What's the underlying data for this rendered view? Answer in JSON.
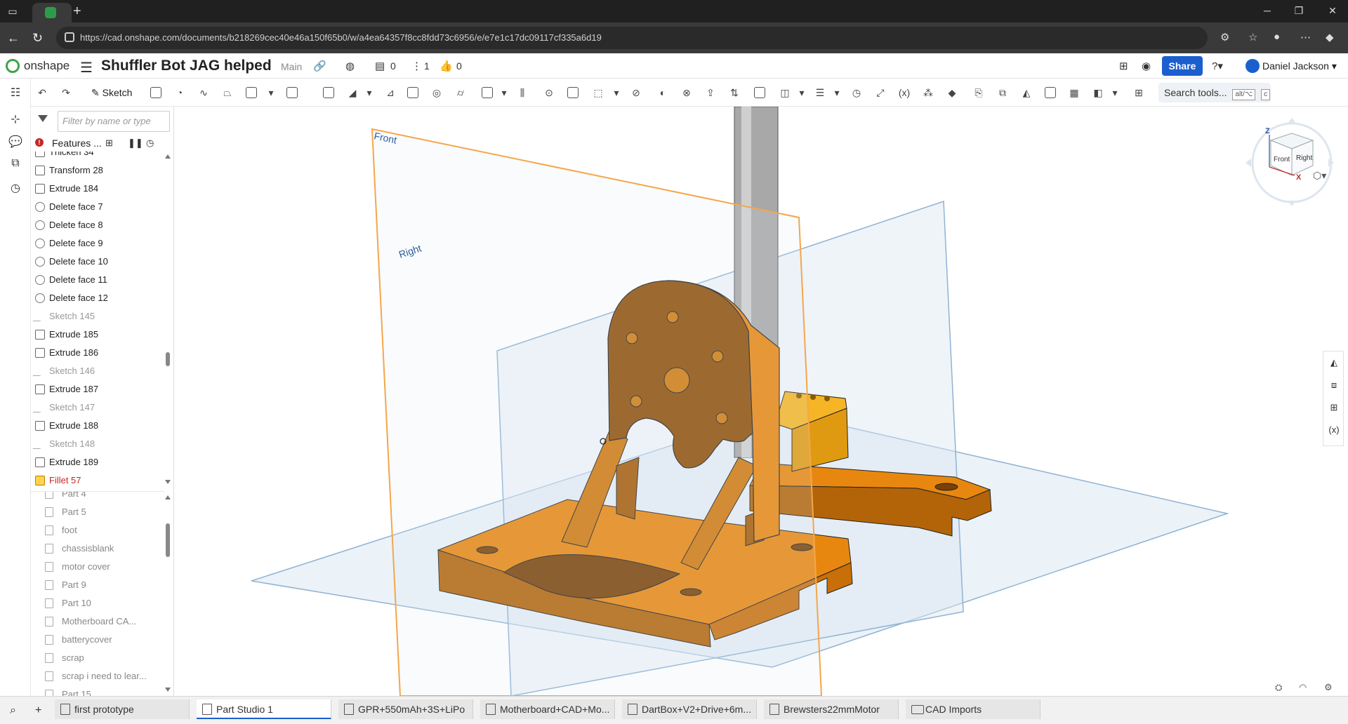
{
  "browser": {
    "url": "https://cad.onshape.com/documents/b218269cec40e46a150f65b0/w/a4ea64357f8cc8fdd73c6956/e/e7e1c17dc09117cf335a6d19"
  },
  "header": {
    "brand": "onshape",
    "document_title": "Shuffler Bot JAG helped",
    "branch": "Main",
    "versions_count": "0",
    "branches_count": "1",
    "likes_count": "0",
    "share_label": "Share",
    "user_name": "Daniel Jackson"
  },
  "toolbar": {
    "sketch_label": "Sketch",
    "search_label": "Search tools...",
    "search_shortcut": "alt/⌥",
    "search_shortcut_key": "c"
  },
  "panel": {
    "filter_placeholder": "Filter by name or type",
    "features_label": "Features ...",
    "features": [
      {
        "label": "Thicken 34",
        "kind": "feature",
        "state": "normal"
      },
      {
        "label": "Transform 28",
        "kind": "feature",
        "state": "normal"
      },
      {
        "label": "Extrude 184",
        "kind": "feature",
        "state": "normal"
      },
      {
        "label": "Delete face 7",
        "kind": "delete",
        "state": "normal"
      },
      {
        "label": "Delete face 8",
        "kind": "delete",
        "state": "normal"
      },
      {
        "label": "Delete face 9",
        "kind": "delete",
        "state": "normal"
      },
      {
        "label": "Delete face 10",
        "kind": "delete",
        "state": "normal"
      },
      {
        "label": "Delete face 11",
        "kind": "delete",
        "state": "normal"
      },
      {
        "label": "Delete face 12",
        "kind": "delete",
        "state": "normal"
      },
      {
        "label": "Sketch 145",
        "kind": "sketch",
        "state": "muted"
      },
      {
        "label": "Extrude 185",
        "kind": "feature",
        "state": "normal"
      },
      {
        "label": "Extrude 186",
        "kind": "feature",
        "state": "normal"
      },
      {
        "label": "Sketch 146",
        "kind": "sketch",
        "state": "muted"
      },
      {
        "label": "Extrude 187",
        "kind": "feature",
        "state": "normal"
      },
      {
        "label": "Sketch 147",
        "kind": "sketch",
        "state": "muted"
      },
      {
        "label": "Extrude 188",
        "kind": "feature",
        "state": "normal"
      },
      {
        "label": "Sketch 148",
        "kind": "sketch",
        "state": "muted"
      },
      {
        "label": "Extrude 189",
        "kind": "feature",
        "state": "normal"
      },
      {
        "label": "Fillet 57",
        "kind": "fillet",
        "state": "error"
      }
    ],
    "parts": [
      "Part 4",
      "Part 5",
      "foot",
      "chassisblank",
      "motor cover",
      "Part 9",
      "Part 10",
      "Motherboard CA...",
      "batterycover",
      "scrap",
      "scrap i need to lear...",
      "Part 15"
    ]
  },
  "viewport": {
    "plane_front": "Front",
    "plane_right": "Right",
    "cube_front": "Front",
    "cube_right": "Right",
    "axis_z": "Z",
    "axis_x": "X",
    "colors": {
      "part": "#e8870f",
      "part_dark": "#b36408",
      "plane_fill": "#dbe7f2",
      "plane_edge": "#8fb3d3",
      "front_plane_edge": "#f5a64a",
      "shaft": "#a8a8a8"
    }
  },
  "tabs": [
    {
      "label": "first prototype",
      "active": false,
      "kind": "assembly"
    },
    {
      "label": "Part Studio 1",
      "active": true,
      "kind": "partstudio"
    },
    {
      "label": "GPR+550mAh+3S+LiPo",
      "active": false,
      "kind": "partstudio"
    },
    {
      "label": "Motherboard+CAD+Mo...",
      "active": false,
      "kind": "partstudio"
    },
    {
      "label": "DartBox+V2+Drive+6m...",
      "active": false,
      "kind": "partstudio"
    },
    {
      "label": "Brewsters22mmMotor",
      "active": false,
      "kind": "partstudio"
    },
    {
      "label": "CAD Imports",
      "active": false,
      "kind": "folder"
    }
  ]
}
